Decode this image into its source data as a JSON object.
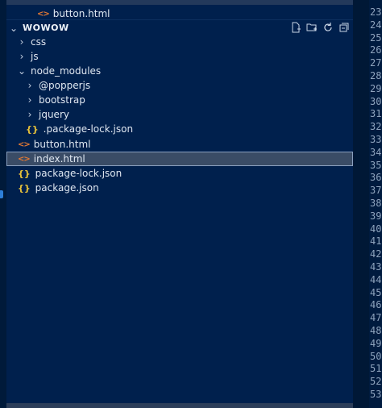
{
  "explorer": {
    "outline_row": {
      "label": "button.html"
    },
    "section": {
      "title": "WOWOW",
      "actions": [
        {
          "name": "new-file-icon"
        },
        {
          "name": "new-folder-icon"
        },
        {
          "name": "refresh-icon"
        },
        {
          "name": "collapse-all-icon"
        }
      ]
    },
    "tree": [
      {
        "label": "css",
        "kind": "folder",
        "depth": 0
      },
      {
        "label": "js",
        "kind": "folder",
        "depth": 0
      },
      {
        "label": "node_modules",
        "kind": "folder-open",
        "depth": 0
      },
      {
        "label": "@popperjs",
        "kind": "folder",
        "depth": 1
      },
      {
        "label": "bootstrap",
        "kind": "folder",
        "depth": 1
      },
      {
        "label": "jquery",
        "kind": "folder",
        "depth": 1
      },
      {
        "label": ".package-lock.json",
        "kind": "json",
        "depth": 1
      },
      {
        "label": "button.html",
        "kind": "html",
        "depth": 0
      },
      {
        "label": "index.html",
        "kind": "html",
        "depth": 0,
        "selected": true
      },
      {
        "label": "package-lock.json",
        "kind": "json",
        "depth": 0
      },
      {
        "label": "package.json",
        "kind": "json",
        "depth": 0
      }
    ]
  },
  "gutter": {
    "line_numbers": [
      "23",
      "24",
      "25",
      "26",
      "27",
      "28",
      "29",
      "30",
      "31",
      "32",
      "33",
      "34",
      "35",
      "36",
      "37",
      "38",
      "39",
      "40",
      "41",
      "42",
      "43",
      "44",
      "45",
      "46",
      "47",
      "48",
      "49",
      "50",
      "51",
      "52",
      "53"
    ]
  },
  "colors": {
    "background": "#001b3f",
    "explorer_bg": "#00204d",
    "selection": "#3a4c66",
    "html_icon": "#e37933",
    "json_icon": "#e8c33a"
  }
}
